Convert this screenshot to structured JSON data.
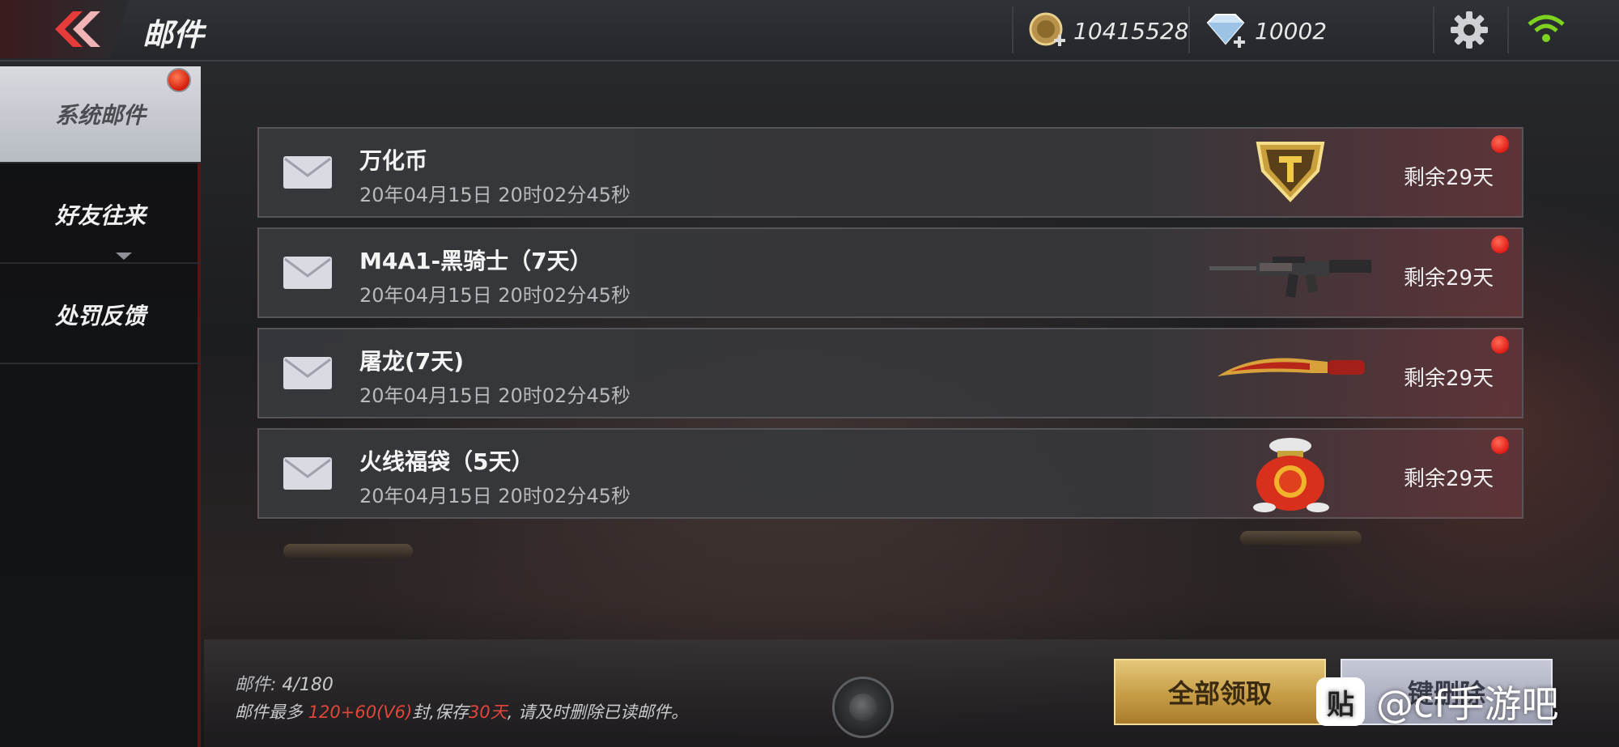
{
  "header": {
    "title": "邮件",
    "gold_amount": "10415528",
    "diamond_amount": "10002"
  },
  "sidebar": {
    "items": [
      {
        "label": "系统邮件"
      },
      {
        "label": "好友往来"
      },
      {
        "label": "处罚反馈"
      }
    ]
  },
  "mails": [
    {
      "title": "万化币",
      "date": "20年04月15日 20时02分45秒",
      "remaining": "剩余29天",
      "icon": "wanhua-coin-icon"
    },
    {
      "title": "M4A1-黑骑士（7天）",
      "date": "20年04月15日 20时02分45秒",
      "remaining": "剩余29天",
      "icon": "rifle-icon"
    },
    {
      "title": "屠龙(7天)",
      "date": "20年04月15日 20时02分45秒",
      "remaining": "剩余29天",
      "icon": "blade-icon"
    },
    {
      "title": "火线福袋（5天）",
      "date": "20年04月15日 20时02分45秒",
      "remaining": "剩余29天",
      "icon": "lucky-bag-icon"
    }
  ],
  "footer": {
    "count_label": "邮件:",
    "count_value": "4/180",
    "info_prefix": "邮件最多 ",
    "info_limit": "120+60(V6)",
    "info_middle": "封,保存",
    "info_days": "30天",
    "info_suffix": ", 请及时删除已读邮件。",
    "claim_all_label": "全部领取",
    "delete_label": "键删除"
  },
  "watermark": {
    "logo_char": "贴",
    "text": "@cf手游吧"
  },
  "colors": {
    "accent_red": "#e11d16",
    "gold_button": "#c79d46"
  }
}
